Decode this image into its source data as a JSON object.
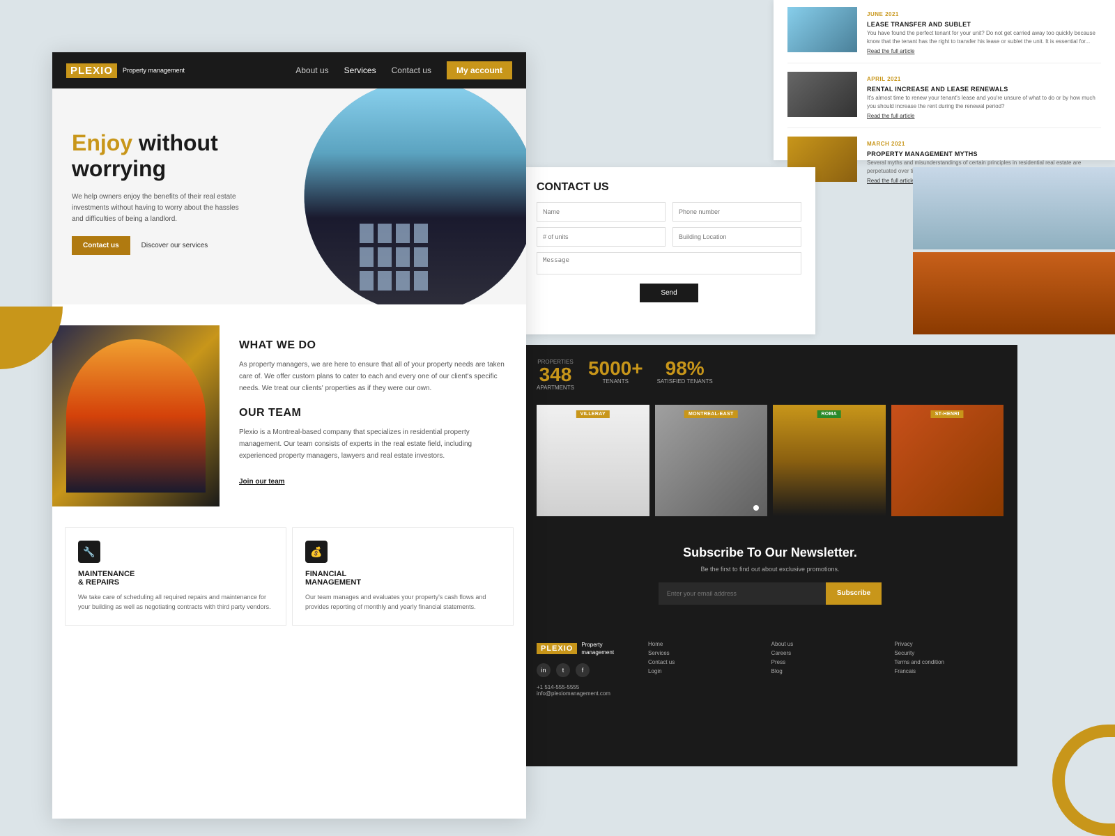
{
  "brand": {
    "name": "PLEXIO",
    "tagline": "Property\nmanagement"
  },
  "navbar": {
    "links": [
      "About us",
      "Services",
      "Contact us"
    ],
    "cta": "My account"
  },
  "hero": {
    "title_bold": "Enjoy",
    "title_rest": " without\nworrying",
    "description": "We help owners enjoy the benefits of their real estate investments without having to worry about the hassles and difficulties of being a landlord.",
    "cta_primary": "Contact us",
    "cta_secondary": "Discover our services"
  },
  "what_we_do": {
    "title": "WHAT WE DO",
    "text": "As property managers, we are here to ensure that all of your property needs are taken care of. We offer custom plans to cater to each and every one of our client's specific needs. We treat our clients' properties as if they were our own."
  },
  "our_team": {
    "title": "OUR TEAM",
    "text": "Plexio is a Montreal-based company that specializes in residential property management. Our team consists of experts in the real estate field, including experienced property managers, lawyers and real estate investors.",
    "link": "Join our team"
  },
  "services": [
    {
      "icon": "🔧",
      "title": "MAINTENANCE\n& REPAIRS",
      "desc": "We take care of scheduling all required repairs and maintenance for your building as well as negotiating contracts with third party vendors."
    },
    {
      "icon": "💰",
      "title": "FINANCIAL\nMANAGEMENT",
      "desc": "Our team manages and evaluates your property's cash flows and provides reporting of monthly and yearly financial statements."
    }
  ],
  "blog": {
    "articles": [
      {
        "tag": "JUNE 2021",
        "title": "LEASE TRANSFER AND SUBLET",
        "excerpt": "You have found the perfect tenant for your unit? Do not get carried away too quickly because know that the tenant has the right to transfer his lease or sublet the unit. It is essential for...",
        "read_more": "Read the full article"
      },
      {
        "tag": "APRIL 2021",
        "title": "RENTAL INCREASE AND LEASE RENEWALS",
        "excerpt": "It's almost time to renew your tenant's lease and you're unsure of what to do or by how much you should increase the rent during the renewal period?",
        "read_more": "Read the full article"
      },
      {
        "tag": "MARCH 2021",
        "title": "PROPERTY MANAGEMENT MYTHS",
        "excerpt": "Several myths and misunderstandings of certain principles in residential real estate are perpetuated over time, often to the detriment of owners. Plexio offers to uncover the most...",
        "read_more": "Read the full article"
      }
    ]
  },
  "contact": {
    "title": "CONTACT US",
    "fields": {
      "name": "Name",
      "phone": "Phone number",
      "units": "# of units",
      "location": "Building Location",
      "message": "Message"
    },
    "send_btn": "Send"
  },
  "stats": [
    {
      "number": "348",
      "label": "APARTMENTS"
    },
    {
      "number": "5000+",
      "label": "TENANTS"
    },
    {
      "number": "98%",
      "label": "SATISFIED TENANTS"
    }
  ],
  "neighborhoods": [
    {
      "label": "VILLERAY",
      "type": "gold"
    },
    {
      "label": "MONTREAL-EAST",
      "type": "gold"
    },
    {
      "label": "ROMA",
      "type": "green"
    },
    {
      "label": "ST-HENRI",
      "type": "gold"
    }
  ],
  "newsletter": {
    "title": "Subscribe To Our Newsletter.",
    "subtitle": "Be the first to find out about exclusive promotions.",
    "placeholder": "Enter your email address",
    "btn": "Subscribe"
  },
  "footer": {
    "phone": "+1 514-555-5555",
    "email": "info@plexiomanagement.com",
    "cols": [
      {
        "title": "",
        "links": [
          "Home",
          "Services",
          "Contact us",
          "Login"
        ]
      },
      {
        "title": "",
        "links": [
          "About us",
          "Careers",
          "Press",
          "Blog"
        ]
      },
      {
        "title": "",
        "links": [
          "Privacy",
          "Security",
          "Terms and condition",
          "Francais"
        ]
      }
    ]
  }
}
